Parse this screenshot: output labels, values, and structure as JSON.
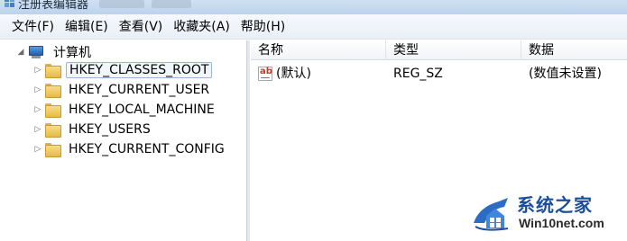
{
  "window": {
    "title": "注册表编辑器"
  },
  "menu": {
    "items": [
      {
        "label": "文件(F)"
      },
      {
        "label": "编辑(E)"
      },
      {
        "label": "查看(V)"
      },
      {
        "label": "收藏夹(A)"
      },
      {
        "label": "帮助(H)"
      }
    ]
  },
  "tree": {
    "root": {
      "label": "计算机",
      "icon": "computer-icon"
    },
    "keys": [
      {
        "label": "HKEY_CLASSES_ROOT",
        "selected": true
      },
      {
        "label": "HKEY_CURRENT_USER"
      },
      {
        "label": "HKEY_LOCAL_MACHINE"
      },
      {
        "label": "HKEY_USERS"
      },
      {
        "label": "HKEY_CURRENT_CONFIG"
      }
    ]
  },
  "list": {
    "columns": [
      {
        "label": "名称"
      },
      {
        "label": "类型"
      },
      {
        "label": "数据"
      }
    ],
    "rows": [
      {
        "icon": "string-value-icon",
        "name": "(默认)",
        "type": "REG_SZ",
        "data": "(数值未设置)"
      }
    ]
  },
  "watermark": {
    "brand": "系统之家",
    "url": "Win10net.com"
  },
  "colors": {
    "accent": "#1b4f9c",
    "folder": "#e7b946",
    "header_bg": "#f1f3f6"
  }
}
